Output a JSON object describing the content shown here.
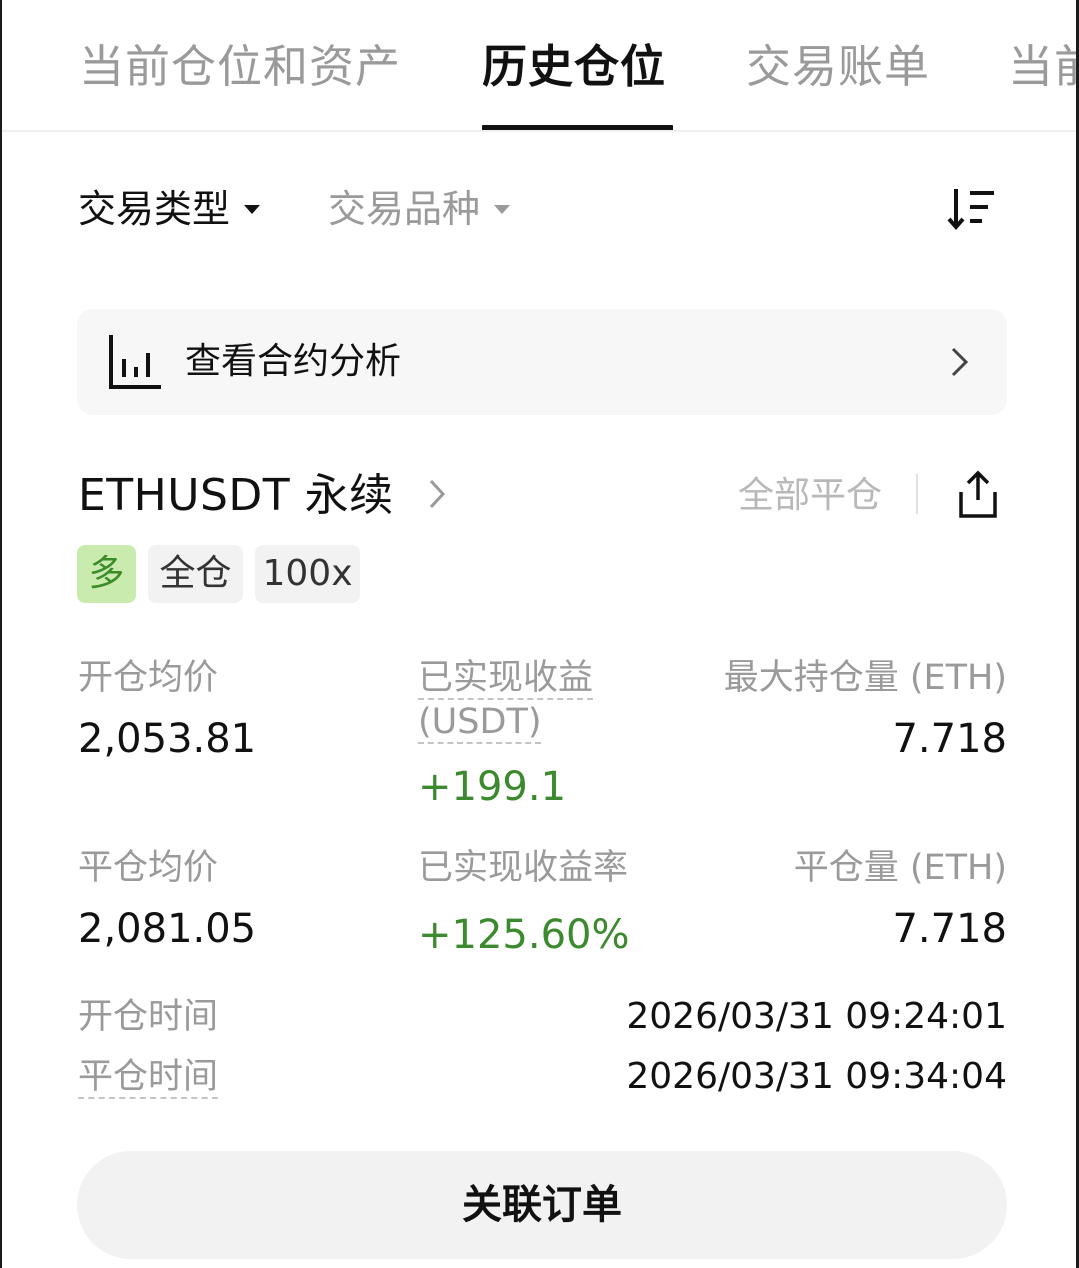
{
  "tabs": [
    {
      "label": "当前仓位和资产",
      "active": false
    },
    {
      "label": "历史仓位",
      "active": true
    },
    {
      "label": "交易账单",
      "active": false
    },
    {
      "label": "当前",
      "active": false
    }
  ],
  "filters": {
    "trade_type": "交易类型",
    "instrument": "交易品种"
  },
  "analysis": {
    "label": "查看合约分析"
  },
  "position": {
    "symbol": "ETHUSDT 永续",
    "close_all": "全部平仓",
    "tags": {
      "side": "多",
      "margin_mode": "全仓",
      "leverage": "100x"
    },
    "stats": {
      "open_avg_label": "开仓均价",
      "open_avg_value": "2,053.81",
      "realized_pnl_label": "已实现收益",
      "realized_pnl_unit": "(USDT)",
      "realized_pnl_value": "+199.1",
      "max_position_label": "最大持仓量 (ETH)",
      "max_position_value": "7.718",
      "close_avg_label": "平仓均价",
      "close_avg_value": "2,081.05",
      "realized_pnl_rate_label": "已实现收益率",
      "realized_pnl_rate_value": "+125.60%",
      "close_qty_label": "平仓量 (ETH)",
      "close_qty_value": "7.718"
    },
    "times": {
      "open_label": "开仓时间",
      "open_value": "2026/03/31 09:24:01",
      "close_label": "平仓时间",
      "close_value": "2026/03/31 09:34:04"
    }
  },
  "related_orders_button": "关联订单",
  "colors": {
    "profit_green": "#3b8a2e",
    "long_tag_bg": "#c9ecae",
    "muted_text": "#9a9a9a"
  },
  "icons": [
    "sort-icon",
    "chart-icon",
    "chevron-right-icon",
    "share-icon",
    "caret-down-icon"
  ]
}
